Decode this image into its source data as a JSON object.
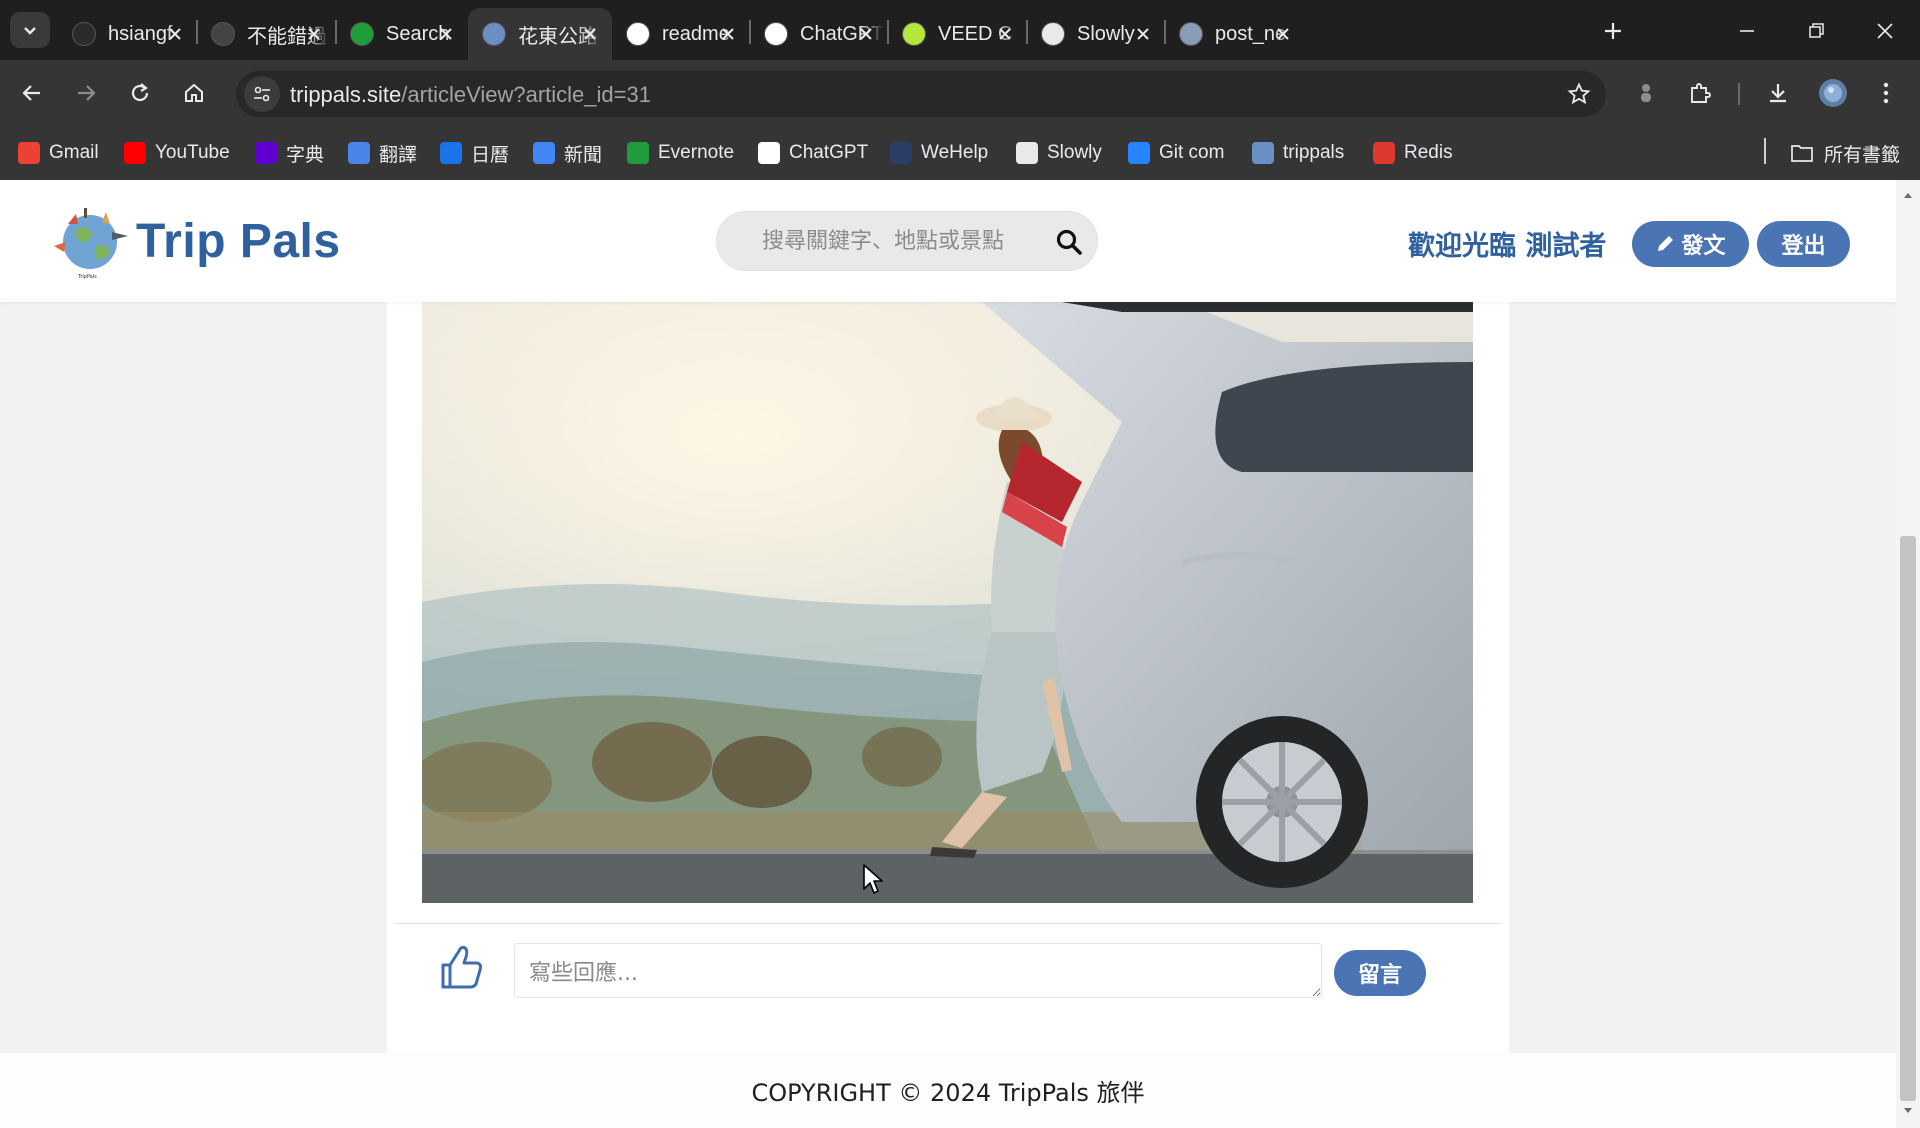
{
  "browser": {
    "tabs": [
      {
        "title": "hsiangf",
        "favicon": "github-icon",
        "color": "#2b2b2b"
      },
      {
        "title": "不能錯過",
        "favicon": "blank-icon",
        "color": "#444444"
      },
      {
        "title": "Search",
        "favicon": "evernote-icon",
        "color": "#1f9d3a"
      },
      {
        "title": "花東公路",
        "favicon": "trippals-icon",
        "color": "#6b8fc5"
      },
      {
        "title": "readme",
        "favicon": "google-icon",
        "color": "#ffffff"
      },
      {
        "title": "ChatGPT",
        "favicon": "chatgpt-icon",
        "color": "#ffffff"
      },
      {
        "title": "VEED C",
        "favicon": "veed-icon",
        "color": "#b6e63e"
      },
      {
        "title": "Slowly",
        "favicon": "slowly-icon",
        "color": "#e9e9e9"
      },
      {
        "title": "post_ne",
        "favicon": "post-icon",
        "color": "#8a9bb8"
      }
    ],
    "url_host": "trippals.site",
    "url_path": "/articleView?article_id=31",
    "bookmarks": [
      {
        "label": "Gmail",
        "icon": "gmail-icon",
        "color": "#ea4335"
      },
      {
        "label": "YouTube",
        "icon": "youtube-icon",
        "color": "#ff0000"
      },
      {
        "label": "字典",
        "icon": "yahoo-icon",
        "color": "#6001d2"
      },
      {
        "label": "翻譯",
        "icon": "translate-icon",
        "color": "#4a86e8"
      },
      {
        "label": "日曆",
        "icon": "calendar-icon",
        "color": "#1a73e8"
      },
      {
        "label": "新聞",
        "icon": "news-icon",
        "color": "#4285f4"
      },
      {
        "label": "Evernote",
        "icon": "evernote-icon",
        "color": "#1f9d3a"
      },
      {
        "label": "ChatGPT",
        "icon": "chatgpt-icon",
        "color": "#ffffff"
      },
      {
        "label": "WeHelp",
        "icon": "wehelp-icon",
        "color": "#2a3f66"
      },
      {
        "label": "Slowly",
        "icon": "slowly-icon",
        "color": "#e9e9e9"
      },
      {
        "label": "Git com",
        "icon": "atlassian-icon",
        "color": "#2684ff"
      },
      {
        "label": "trippals",
        "icon": "trippals-icon",
        "color": "#6b8fc5"
      },
      {
        "label": "Redis",
        "icon": "redis-icon",
        "color": "#dc382d"
      }
    ],
    "all_bookmarks": "所有書籤"
  },
  "site": {
    "brand": "Trip Pals",
    "search_placeholder": "搜尋關鍵字、地點或景點",
    "welcome": "歡迎光臨 測試者",
    "post_button": "發文",
    "logout_button": "登出",
    "comment_placeholder": "寫些回應...",
    "comment_button": "留言",
    "footer": "COPYRIGHT © 2024 TripPals 旅伴",
    "accent": "#30619f",
    "button_color": "#4a74b3"
  }
}
